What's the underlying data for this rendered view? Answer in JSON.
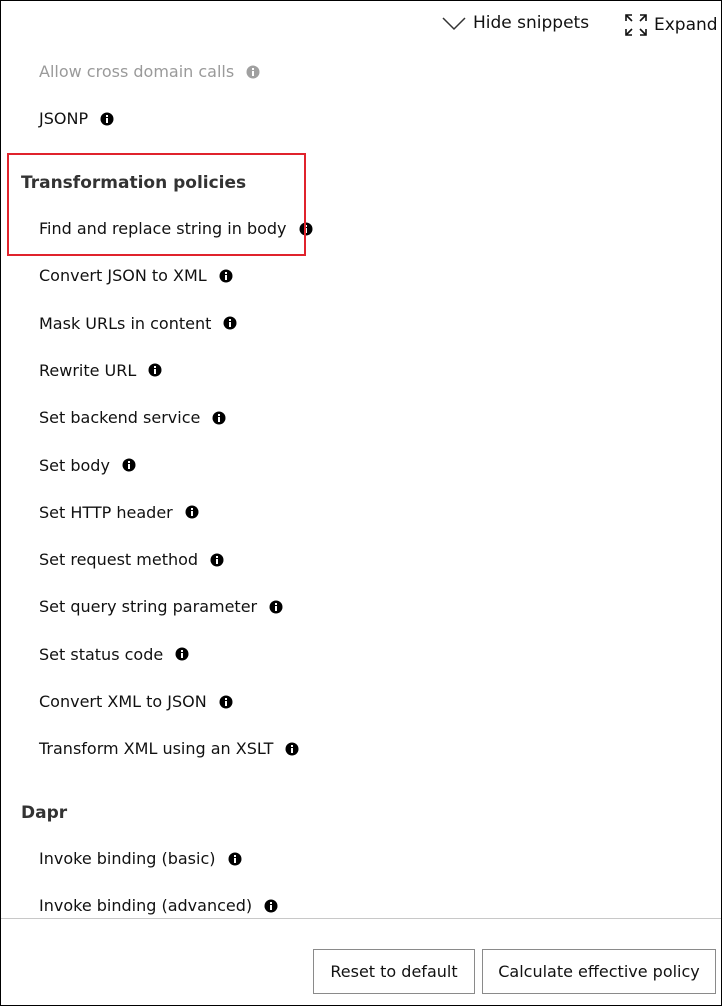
{
  "toolbar": {
    "hide_snippets": "Hide snippets",
    "expand": "Expand"
  },
  "items_top": [
    {
      "label": "Allow cross domain calls",
      "disabled": true
    },
    {
      "label": "JSONP",
      "disabled": false
    }
  ],
  "sections": [
    {
      "title": "Transformation policies",
      "items": [
        "Find and replace string in body",
        "Convert JSON to XML",
        "Mask URLs in content",
        "Rewrite URL",
        "Set backend service",
        "Set body",
        "Set HTTP header",
        "Set request method",
        "Set query string parameter",
        "Set status code",
        "Convert XML to JSON",
        "Transform XML using an XSLT"
      ]
    },
    {
      "title": "Dapr",
      "items": [
        "Invoke binding (basic)",
        "Invoke binding (advanced)"
      ]
    }
  ],
  "footer": {
    "reset": "Reset to default",
    "calculate": "Calculate effective policy"
  },
  "colors": {
    "highlight": "#e0232c",
    "disabled_text": "#9a9a9a"
  }
}
